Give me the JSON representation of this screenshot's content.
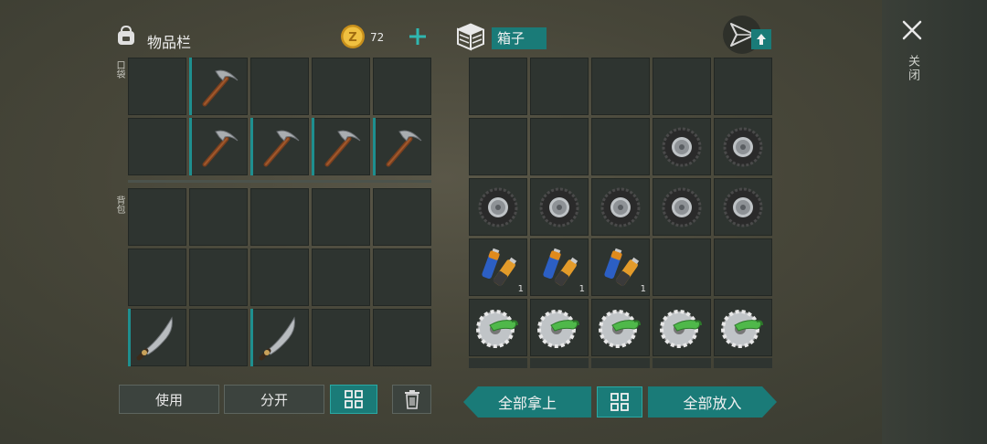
{
  "inventory": {
    "title": "物品栏",
    "coins": "72",
    "pocket_label": "口袋",
    "backpack_label": "背包"
  },
  "container": {
    "title": "箱子"
  },
  "side": {
    "close_label": "关闭"
  },
  "buttons": {
    "use": "使用",
    "split": "分开",
    "take_all": "全部拿上",
    "put_all": "全部放入"
  },
  "pocket_slots": [
    {
      "item": "empty"
    },
    {
      "item": "pickaxe"
    },
    {
      "item": "empty"
    },
    {
      "item": "empty"
    },
    {
      "item": "empty"
    },
    {
      "item": "empty"
    },
    {
      "item": "pickaxe"
    },
    {
      "item": "pickaxe"
    },
    {
      "item": "pickaxe"
    },
    {
      "item": "pickaxe"
    }
  ],
  "backpack_slots": [
    {
      "item": "empty"
    },
    {
      "item": "empty"
    },
    {
      "item": "empty"
    },
    {
      "item": "empty"
    },
    {
      "item": "empty"
    },
    {
      "item": "empty"
    },
    {
      "item": "empty"
    },
    {
      "item": "empty"
    },
    {
      "item": "empty"
    },
    {
      "item": "empty"
    },
    {
      "item": "machete"
    },
    {
      "item": "empty"
    },
    {
      "item": "machete"
    },
    {
      "item": "empty"
    },
    {
      "item": "empty"
    }
  ],
  "box_slots": [
    {
      "item": "empty"
    },
    {
      "item": "empty"
    },
    {
      "item": "empty"
    },
    {
      "item": "empty"
    },
    {
      "item": "empty"
    },
    {
      "item": "empty"
    },
    {
      "item": "empty"
    },
    {
      "item": "empty"
    },
    {
      "item": "tire"
    },
    {
      "item": "tire"
    },
    {
      "item": "tire"
    },
    {
      "item": "tire"
    },
    {
      "item": "tire"
    },
    {
      "item": "tire"
    },
    {
      "item": "tire"
    },
    {
      "item": "batteries",
      "qty": "1"
    },
    {
      "item": "batteries",
      "qty": "1"
    },
    {
      "item": "batteries",
      "qty": "1"
    },
    {
      "item": "empty"
    },
    {
      "item": "empty"
    },
    {
      "item": "saw_blade"
    },
    {
      "item": "saw_blade"
    },
    {
      "item": "saw_blade"
    },
    {
      "item": "saw_blade"
    },
    {
      "item": "saw_blade"
    }
  ],
  "colors": {
    "accent": "#1a7b78",
    "slot_bg": "#2e3430",
    "coin": "#e0b030"
  }
}
